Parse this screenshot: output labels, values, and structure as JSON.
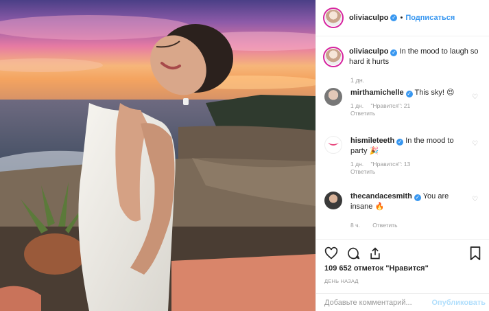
{
  "post": {
    "author": "oliviaculpo",
    "follow_label": "Подписаться",
    "caption_text": "In the mood to laugh so hard it hurts",
    "caption_time": "1 дн."
  },
  "comments": [
    {
      "user": "mirthamichelle",
      "text": "This sky! 😍",
      "time": "1 дн.",
      "likes": "\"Нравится\": 21",
      "reply": "Ответить"
    },
    {
      "user": "hismileteeth",
      "text": "In the mood to party 🎉",
      "time": "1 дн.",
      "likes": "\"Нравится\": 13",
      "reply": "Ответить"
    },
    {
      "user": "thecandacesmith",
      "text": "You are insane 🔥",
      "time": "8 ч.",
      "reply": "Ответить"
    }
  ],
  "footer": {
    "likes_count": "109 652 отметок \"Нравится\"",
    "posted_when": "ДЕНЬ НАЗАД",
    "comment_placeholder": "Добавьте комментарий...",
    "publish_label": "Опубликовать"
  },
  "colors": {
    "accent": "#3897f0",
    "publish_disabled": "#b2dffc",
    "muted": "#999999"
  },
  "icons": [
    "verified-icon",
    "heart-icon",
    "comment-icon",
    "share-icon",
    "bookmark-icon"
  ]
}
